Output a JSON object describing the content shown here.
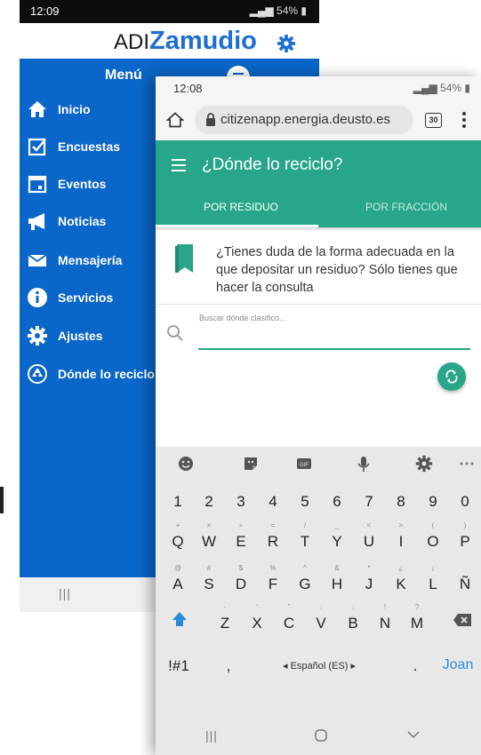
{
  "back_app": {
    "status": {
      "time": "12:09",
      "battery": "54%"
    },
    "logo": {
      "prefix": "ADI",
      "name": "Zamudio"
    },
    "menu": {
      "title": "Menú",
      "items": [
        {
          "label": "Inicio",
          "icon": "home-icon"
        },
        {
          "label": "Encuestas",
          "icon": "checkbox-icon"
        },
        {
          "label": "Eventos",
          "icon": "calendar-icon"
        },
        {
          "label": "Noticias",
          "icon": "megaphone-icon"
        },
        {
          "label": "Mensajería",
          "icon": "envelope-icon"
        },
        {
          "label": "Servicios",
          "icon": "info-icon"
        },
        {
          "label": "Ajustes",
          "icon": "gear-icon"
        },
        {
          "label": "Dónde lo reciclo",
          "icon": "recycle-icon"
        }
      ]
    },
    "nav": {
      "recents": "|||"
    }
  },
  "front_app": {
    "status": {
      "time": "12:08",
      "battery": "54%"
    },
    "browser": {
      "url": "citizenapp.energia.deusto.es",
      "tab_count": "30"
    },
    "header": {
      "title": "¿Dónde lo reciclo?",
      "tabs": [
        {
          "label": "POR RESIDUO",
          "active": true
        },
        {
          "label": "POR FRACCIÓN",
          "active": false
        }
      ]
    },
    "info_text": "¿Tienes duda de la forma adecuada en la que depositar un residuo? Sólo tienes que hacer la consulta",
    "search": {
      "label": "Buscar dónde clasifico...",
      "value": ""
    },
    "keyboard": {
      "numbers": [
        "1",
        "2",
        "3",
        "4",
        "5",
        "6",
        "7",
        "8",
        "9",
        "0"
      ],
      "row1": [
        {
          "k": "Q",
          "s": "+"
        },
        {
          "k": "W",
          "s": "×"
        },
        {
          "k": "E",
          "s": "÷"
        },
        {
          "k": "R",
          "s": "="
        },
        {
          "k": "T",
          "s": "/"
        },
        {
          "k": "Y",
          "s": "_"
        },
        {
          "k": "U",
          "s": "<"
        },
        {
          "k": "I",
          "s": ">"
        },
        {
          "k": "O",
          "s": "("
        },
        {
          "k": "P",
          "s": ")"
        }
      ],
      "row2": [
        {
          "k": "A",
          "s": "@"
        },
        {
          "k": "S",
          "s": "#"
        },
        {
          "k": "D",
          "s": "$"
        },
        {
          "k": "F",
          "s": "%"
        },
        {
          "k": "G",
          "s": "^"
        },
        {
          "k": "H",
          "s": "&"
        },
        {
          "k": "J",
          "s": "*"
        },
        {
          "k": "K",
          "s": "¿"
        },
        {
          "k": "L",
          "s": "¡"
        },
        {
          "k": "Ñ",
          "s": ""
        }
      ],
      "row3": [
        {
          "k": "Z",
          "s": "-"
        },
        {
          "k": "X",
          "s": "'"
        },
        {
          "k": "C",
          "s": "\""
        },
        {
          "k": "V",
          "s": ":"
        },
        {
          "k": "B",
          "s": ";"
        },
        {
          "k": "N",
          "s": "!"
        },
        {
          "k": "M",
          "s": "?"
        }
      ],
      "symbols_key": "!#1",
      "comma_key": ",",
      "space_label": "◂ Español (ES) ▸",
      "period_key": ".",
      "suggestion": "Joan",
      "accent": "#2a8adf"
    },
    "nav": {
      "recents": "|||"
    }
  },
  "colors": {
    "menu_blue": "#0a66c8",
    "logo_blue": "#1d6fd1",
    "app_green": "#27a689"
  }
}
